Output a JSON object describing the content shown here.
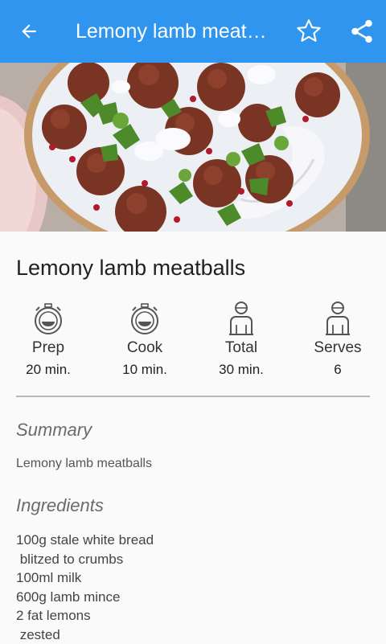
{
  "appbar": {
    "title": "Lemony lamb meatballs",
    "bg": "#2f95ee"
  },
  "icons": {
    "back": "arrow-back-icon",
    "favorite": "star-outline-icon",
    "share": "share-icon",
    "prep": "timer-icon",
    "cook": "timer-icon",
    "total": "person-icon",
    "serves": "person-icon"
  },
  "recipe": {
    "title": "Lemony lamb meatballs",
    "stats": [
      {
        "label": "Prep",
        "value": "20 min."
      },
      {
        "label": "Cook",
        "value": "10 min."
      },
      {
        "label": "Total",
        "value": "30 min."
      },
      {
        "label": "Serves",
        "value": "6"
      }
    ],
    "summary_heading": "Summary",
    "summary_text": "Lemony lamb meatballs",
    "ingredients_heading": "Ingredients",
    "ingredients": [
      "100g stale white bread",
      " blitzed to crumbs",
      "100ml milk",
      "600g lamb mince",
      "2 fat lemons",
      " zested"
    ]
  }
}
